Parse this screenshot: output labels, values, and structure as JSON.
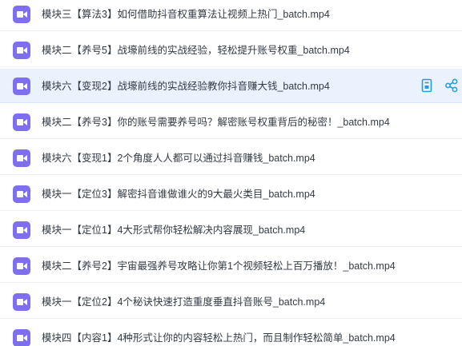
{
  "files": [
    {
      "name": "模块三【算法3】如何借助抖音权重算法让视频上热门_batch.mp4",
      "icon": "video-file-icon"
    },
    {
      "name": "模块二【养号5】战壕前线的实战经验，轻松提升账号权重_batch.mp4",
      "icon": "video-file-icon"
    },
    {
      "name": "模块六【变现2】战壕前线的实战经验教你抖音赚大钱_batch.mp4",
      "icon": "video-file-icon",
      "selected": true,
      "actions": [
        "detail-icon",
        "share-icon"
      ]
    },
    {
      "name": "模块二【养号3】你的账号需要养号吗？解密账号权重背后的秘密！_batch.mp4",
      "icon": "video-file-icon"
    },
    {
      "name": "模块六【变现1】2个角度人人都可以通过抖音赚钱_batch.mp4",
      "icon": "video-file-icon"
    },
    {
      "name": "模块一【定位3】解密抖音谁做谁火的9大最火类目_batch.mp4",
      "icon": "video-file-icon"
    },
    {
      "name": "模块一【定位1】4大形式帮你轻松解决内容展现_batch.mp4",
      "icon": "video-file-icon"
    },
    {
      "name": "模块二【养号2】宇宙最强养号攻略让你第1个视频轻松上百万播放！_batch.mp4",
      "icon": "video-file-icon"
    },
    {
      "name": "模块一【定位2】4个秘诀快速打造重度垂直抖音账号_batch.mp4",
      "icon": "video-file-icon"
    },
    {
      "name": "模块四【内容1】4种形式让你的内容轻松上热门，而且制作轻松简单_batch.mp4",
      "icon": "video-file-icon"
    }
  ],
  "colors": {
    "icon": "#7d6ff0",
    "selected_row": "#eaf3fd",
    "action": "#2a9bd8",
    "text": "#333a44"
  }
}
